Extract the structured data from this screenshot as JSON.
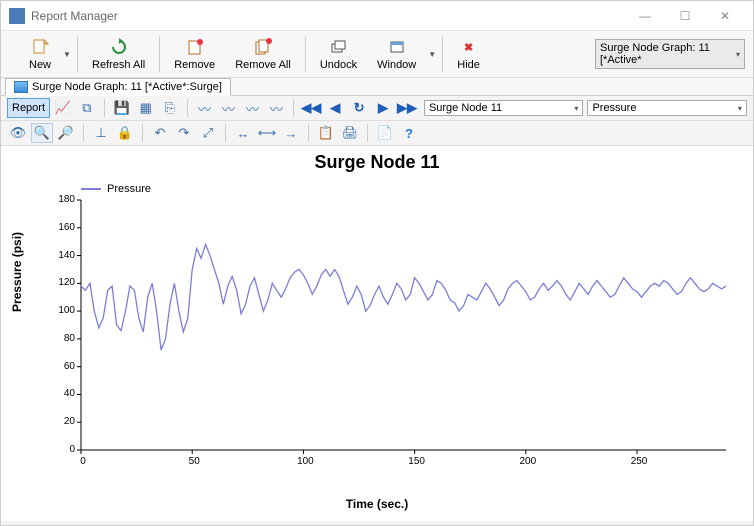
{
  "window": {
    "title": "Report Manager"
  },
  "toolbar": {
    "new": "New",
    "refresh_all": "Refresh All",
    "remove": "Remove",
    "remove_all": "Remove All",
    "undock": "Undock",
    "window": "Window",
    "hide": "Hide"
  },
  "top_dropdown": {
    "label": "Surge Node Graph: 11 [*Active*"
  },
  "tab": {
    "label": "Surge Node Graph: 11 [*Active*:Surge]"
  },
  "report_btn": "Report",
  "node_select": "Surge Node 11",
  "series_select": "Pressure",
  "chart_data": {
    "type": "line",
    "title": "Surge Node 11",
    "xlabel": "Time (sec.)",
    "ylabel": "Pressure (psi)",
    "xlim": [
      0,
      290
    ],
    "ylim": [
      0,
      180
    ],
    "xticks": [
      0,
      50,
      100,
      150,
      200,
      250
    ],
    "yticks": [
      0,
      20,
      40,
      60,
      80,
      100,
      120,
      140,
      160,
      180
    ],
    "series": [
      {
        "name": "Pressure",
        "color": "#7b7ed6",
        "x": [
          0,
          2,
          4,
          6,
          8,
          10,
          12,
          14,
          16,
          18,
          20,
          22,
          24,
          26,
          28,
          30,
          32,
          34,
          36,
          38,
          40,
          42,
          44,
          46,
          48,
          50,
          52,
          54,
          56,
          58,
          60,
          62,
          64,
          66,
          68,
          70,
          72,
          74,
          76,
          78,
          80,
          82,
          84,
          86,
          88,
          90,
          92,
          94,
          96,
          98,
          100,
          102,
          104,
          106,
          108,
          110,
          112,
          114,
          116,
          118,
          120,
          122,
          124,
          126,
          128,
          130,
          132,
          134,
          136,
          138,
          140,
          142,
          144,
          146,
          148,
          150,
          152,
          154,
          156,
          158,
          160,
          162,
          164,
          166,
          168,
          170,
          172,
          174,
          176,
          178,
          180,
          182,
          184,
          186,
          188,
          190,
          192,
          194,
          196,
          198,
          200,
          202,
          204,
          206,
          208,
          210,
          212,
          214,
          216,
          218,
          220,
          222,
          224,
          226,
          228,
          230,
          232,
          234,
          236,
          238,
          240,
          242,
          244,
          246,
          248,
          250,
          252,
          254,
          256,
          258,
          260,
          262,
          264,
          266,
          268,
          270,
          272,
          274,
          276,
          278,
          280,
          282,
          284,
          286,
          288,
          290
        ],
        "y": [
          118,
          115,
          120,
          100,
          88,
          95,
          115,
          118,
          90,
          86,
          100,
          118,
          115,
          95,
          85,
          110,
          120,
          100,
          72,
          80,
          105,
          120,
          100,
          85,
          95,
          130,
          145,
          138,
          148,
          140,
          130,
          120,
          105,
          118,
          125,
          115,
          98,
          105,
          118,
          124,
          112,
          100,
          108,
          120,
          115,
          110,
          116,
          124,
          128,
          130,
          126,
          120,
          112,
          118,
          126,
          130,
          125,
          130,
          125,
          115,
          105,
          110,
          118,
          112,
          100,
          104,
          112,
          118,
          110,
          105,
          112,
          120,
          116,
          108,
          112,
          124,
          120,
          114,
          108,
          112,
          122,
          120,
          115,
          108,
          106,
          100,
          104,
          112,
          110,
          108,
          114,
          120,
          116,
          110,
          104,
          108,
          116,
          120,
          122,
          118,
          114,
          108,
          110,
          116,
          120,
          115,
          118,
          122,
          118,
          112,
          108,
          114,
          120,
          116,
          112,
          118,
          122,
          118,
          114,
          110,
          112,
          118,
          124,
          120,
          116,
          114,
          110,
          114,
          118,
          120,
          118,
          122,
          120,
          116,
          112,
          114,
          120,
          124,
          120,
          116,
          114,
          116,
          120,
          118,
          116,
          118
        ]
      }
    ]
  }
}
